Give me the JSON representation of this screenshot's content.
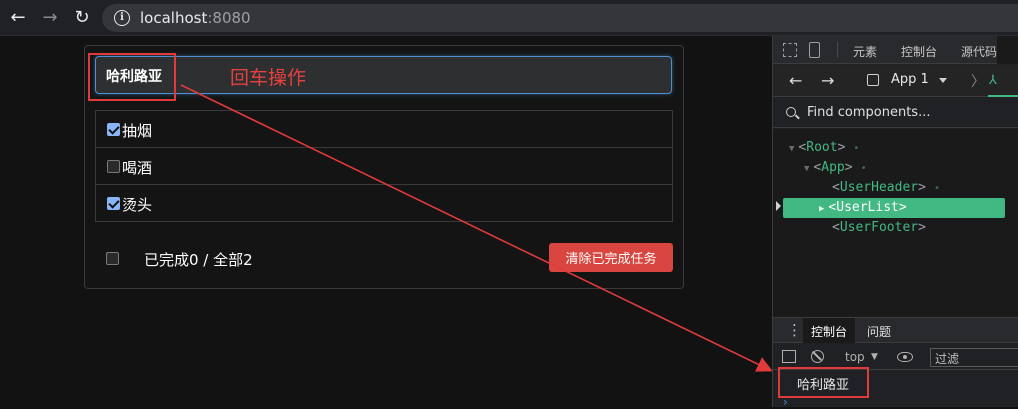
{
  "browser": {
    "url_host": "localhost",
    "url_port": ":8080"
  },
  "todo": {
    "input_value": "哈利路亚",
    "annotation": "回车操作",
    "items": [
      {
        "text": "抽烟",
        "done": true
      },
      {
        "text": "喝酒",
        "done": false
      },
      {
        "text": "烫头",
        "done": true
      }
    ],
    "footer_status": "已完成0 / 全部2",
    "clear_button": "清除已完成任务"
  },
  "devtools": {
    "tabs": [
      "元素",
      "控制台",
      "源代码"
    ],
    "app_selector": "App 1",
    "find_placeholder": "Find components...",
    "tree": {
      "root": "Root",
      "app": "App",
      "user_header": "UserHeader",
      "user_list": "UserList",
      "user_footer": "UserFooter"
    },
    "console_tabs": [
      "控制台",
      "问题"
    ],
    "context": "top",
    "filter_placeholder": "过滤",
    "log_output": "哈利路亚"
  },
  "colors": {
    "vue_green": "#42b883",
    "danger": "#d9453f",
    "annotation_red": "#e03a3a",
    "focus_blue": "#4f8fcf"
  }
}
